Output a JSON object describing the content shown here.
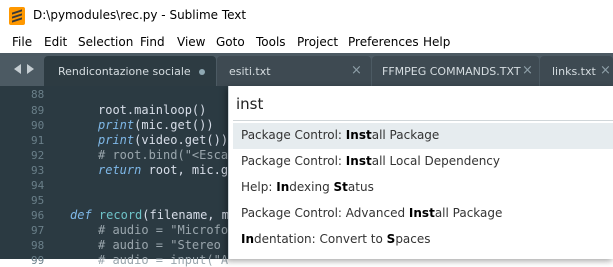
{
  "window": {
    "title": "D:\\pymodules\\rec.py - Sublime Text",
    "colors": {
      "tabbar": "#4c5a63",
      "editor_bg": "#2b3a42",
      "accent_icon": "#ff9800",
      "selected_row": "#e6ecef"
    }
  },
  "menu": [
    "File",
    "Edit",
    "Selection",
    "Find",
    "View",
    "Goto",
    "Tools",
    "Project",
    "Preferences",
    "Help"
  ],
  "tabs": [
    {
      "label": "Rendicontazione sociale",
      "indicator": "dot"
    },
    {
      "label": "esiti.txt",
      "indicator": "close"
    },
    {
      "label": "FFMPEG COMMANDS.TXT",
      "indicator": "close"
    },
    {
      "label": "links.txt",
      "indicator": "close"
    }
  ],
  "editor": {
    "line_numbers": [
      "88",
      "89",
      "90",
      "91",
      "92",
      "93",
      "94",
      "95",
      "96",
      "97",
      "98",
      "99"
    ],
    "code": {
      "l89": "root.mainloop()",
      "l90_kw": "print",
      "l90_rest": "(mic.get())",
      "l91_kw": "print",
      "l91_rest": "(video.get())",
      "l92": "# root.bind(\"<Escap",
      "l93_kw": "return",
      "l93_rest": " root, mic.ge",
      "l96_kw": "def",
      "l96_fn": "record",
      "l96_rest": "(filename, mi",
      "l97": "# audio = \"Microfon",
      "l98": "# audio = \"Stereo M",
      "l99": "# audio = input(\"A"
    }
  },
  "command_palette": {
    "query": "inst",
    "items": [
      {
        "text": "Package Control: Install Package"
      },
      {
        "text": "Package Control: Install Local Dependency"
      },
      {
        "text": "Help: Indexing Status"
      },
      {
        "text": "Package Control: Advanced Install Package"
      },
      {
        "text": "Indentation: Convert to Spaces"
      }
    ]
  },
  "icons": [
    "sublime-text-logo-icon",
    "tab-nav-left-icon",
    "tab-nav-right-icon",
    "dirty-dot-icon",
    "close-icon"
  ]
}
